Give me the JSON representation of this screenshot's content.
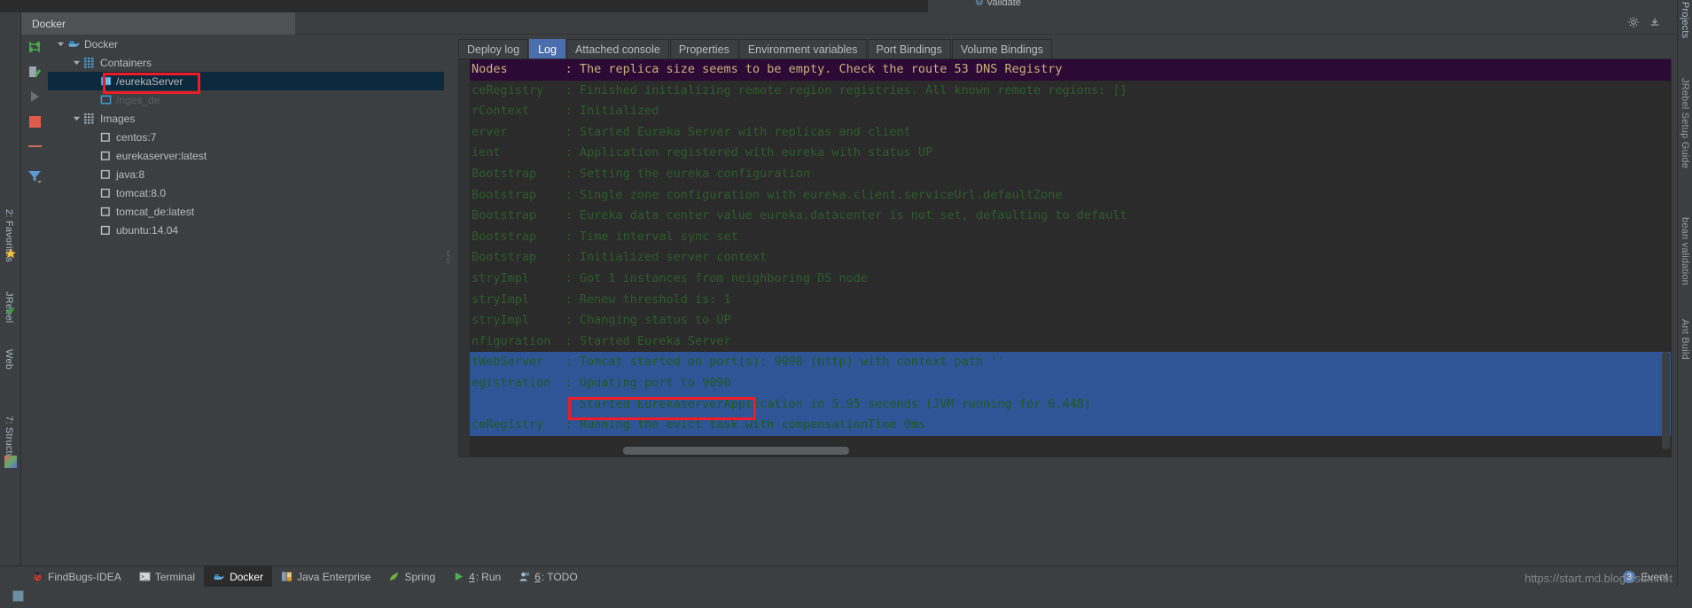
{
  "window": {
    "panel_title": "Docker",
    "validate_label": "Validate"
  },
  "right_rail": [
    {
      "label": "Projects"
    },
    {
      "label": "JRebel Setup Guide"
    },
    {
      "label": "bean validation"
    },
    {
      "label": "Ant Build"
    }
  ],
  "left_rail": [
    {
      "label": "2: Favorites"
    },
    {
      "label": "JRebel"
    },
    {
      "label": "Web"
    },
    {
      "label": "7: Structure"
    }
  ],
  "toolbar": {
    "buttons": [
      {
        "name": "deploy-icon",
        "title": "Deploy"
      },
      {
        "name": "edit-configuration-icon",
        "title": "Edit Configuration"
      },
      {
        "name": "run-icon",
        "title": "Run"
      },
      {
        "name": "stop-icon",
        "title": "Stop"
      },
      {
        "name": "remove-icon",
        "title": "Remove"
      },
      {
        "name": "filter-icon",
        "title": "Filter"
      }
    ]
  },
  "header_icons": [
    {
      "name": "gear-icon",
      "title": "Settings"
    },
    {
      "name": "hide-icon",
      "title": "Hide"
    }
  ],
  "tree": {
    "nodes": [
      {
        "label": "Docker",
        "depth": 0,
        "icon": "docker-whale-icon",
        "arrow": "down",
        "selected": false,
        "blurred": false
      },
      {
        "label": "Containers",
        "depth": 1,
        "icon": "containers-grid-icon",
        "arrow": "down",
        "selected": false,
        "blurred": false
      },
      {
        "label": "/eurekaServer",
        "depth": 2,
        "icon": "container-running-icon",
        "arrow": "none",
        "selected": true,
        "blurred": false
      },
      {
        "label": "/nges_de",
        "depth": 2,
        "icon": "container-stopped-icon",
        "arrow": "none",
        "selected": false,
        "blurred": true
      },
      {
        "label": "Images",
        "depth": 1,
        "icon": "images-grid-icon",
        "arrow": "down",
        "selected": false,
        "blurred": false
      },
      {
        "label": "centos:7",
        "depth": 2,
        "icon": "image-icon",
        "arrow": "none",
        "selected": false,
        "blurred": false
      },
      {
        "label": "eurekaserver:latest",
        "depth": 2,
        "icon": "image-icon",
        "arrow": "none",
        "selected": false,
        "blurred": false
      },
      {
        "label": "java:8",
        "depth": 2,
        "icon": "image-icon",
        "arrow": "none",
        "selected": false,
        "blurred": false
      },
      {
        "label": "tomcat:8.0",
        "depth": 2,
        "icon": "image-icon",
        "arrow": "none",
        "selected": false,
        "blurred": false
      },
      {
        "label": "tomcat_de:latest",
        "depth": 2,
        "icon": "image-icon",
        "arrow": "none",
        "selected": false,
        "blurred": false
      },
      {
        "label": "ubuntu:14.04",
        "depth": 2,
        "icon": "image-icon",
        "arrow": "none",
        "selected": false,
        "blurred": false
      }
    ]
  },
  "content_tabs": [
    {
      "label": "Deploy log",
      "active": false
    },
    {
      "label": "Log",
      "active": true
    },
    {
      "label": "Attached console",
      "active": false
    },
    {
      "label": "Properties",
      "active": false
    },
    {
      "label": "Environment variables",
      "active": false
    },
    {
      "label": "Port Bindings",
      "active": false
    },
    {
      "label": "Volume Bindings",
      "active": false
    }
  ],
  "log": {
    "lines": [
      {
        "text": "Nodes        : The replica size seems to be empty. Check the route 53 DNS Registry",
        "style": "first"
      },
      {
        "text": "ceRegistry   : Finished initializing remote region registries. All known remote regions: []",
        "style": "dim"
      },
      {
        "text": "rContext     : Initialized",
        "style": "dim"
      },
      {
        "text": "erver        : Started Eureka Server with replicas and client",
        "style": "dim"
      },
      {
        "text": "ient         : Application registered with eureka with status UP",
        "style": "dim"
      },
      {
        "text": "Bootstrap    : Setting the eureka configuration",
        "style": "dim"
      },
      {
        "text": "Bootstrap    : Single zone configuration with eureka.client.serviceUrl.defaultZone",
        "style": "dim"
      },
      {
        "text": "Bootstrap    : Eureka data center value eureka.datacenter is not set, defaulting to default",
        "style": "dim"
      },
      {
        "text": "Bootstrap    : Time interval sync set",
        "style": "dim"
      },
      {
        "text": "Bootstrap    : Initialized server context",
        "style": "dim"
      },
      {
        "text": "stryImpl     : Got 1 instances from neighboring DS node",
        "style": "dim"
      },
      {
        "text": "stryImpl     : Renew threshold is: 1",
        "style": "dim"
      },
      {
        "text": "stryImpl     : Changing status to UP",
        "style": "dim"
      },
      {
        "text": "nfiguration  : Started Eureka Server",
        "style": "dim"
      },
      {
        "text": "tWebServer   : Tomcat started on port(s): 9090 (http) with context path ''",
        "style": "sel"
      },
      {
        "text": "egistration  : Updating port to 9090",
        "style": "sel"
      },
      {
        "text": "             : Started EurekaserverApplication in 5.95 seconds (JVM running for 6.448)",
        "style": "sel"
      },
      {
        "text": "ceRegistry   : Running the evict task with compensationTime 0ms",
        "style": "sel"
      }
    ]
  },
  "annotations": {
    "redbox_tree_label": "/eurekaServer",
    "redbox_log_label": "Updating port to 9090"
  },
  "statusbar": {
    "items": [
      {
        "label": "FindBugs-IDEA",
        "icon": "bug-icon",
        "active": false,
        "mnemonic": ""
      },
      {
        "label": "Terminal",
        "icon": "terminal-icon",
        "active": false,
        "mnemonic": ""
      },
      {
        "label": "Docker",
        "icon": "docker-icon",
        "active": true,
        "mnemonic": ""
      },
      {
        "label": "Java Enterprise",
        "icon": "java-ee-icon",
        "active": false,
        "mnemonic": ""
      },
      {
        "label": "Spring",
        "icon": "spring-leaf-icon",
        "active": false,
        "mnemonic": ""
      },
      {
        "label": "Run",
        "icon": "run-play-icon",
        "active": false,
        "mnemonic": "4"
      },
      {
        "label": "TODO",
        "icon": "todo-icon",
        "active": false,
        "mnemonic": "6"
      }
    ],
    "events_label": "Event",
    "events_count": "3",
    "watermark": "https://start.md.blog.csdn.net"
  },
  "colors": {
    "accent_blue": "#4b6eaf",
    "selection_blue": "#2f5597",
    "tree_selection": "#0d293e",
    "annotation_red": "#ee1c25",
    "log_green": "#2a6b2a",
    "log_first_bg": "#2b0b36",
    "panel_bg": "#3c3f41",
    "editor_bg": "#2b2b2b"
  }
}
